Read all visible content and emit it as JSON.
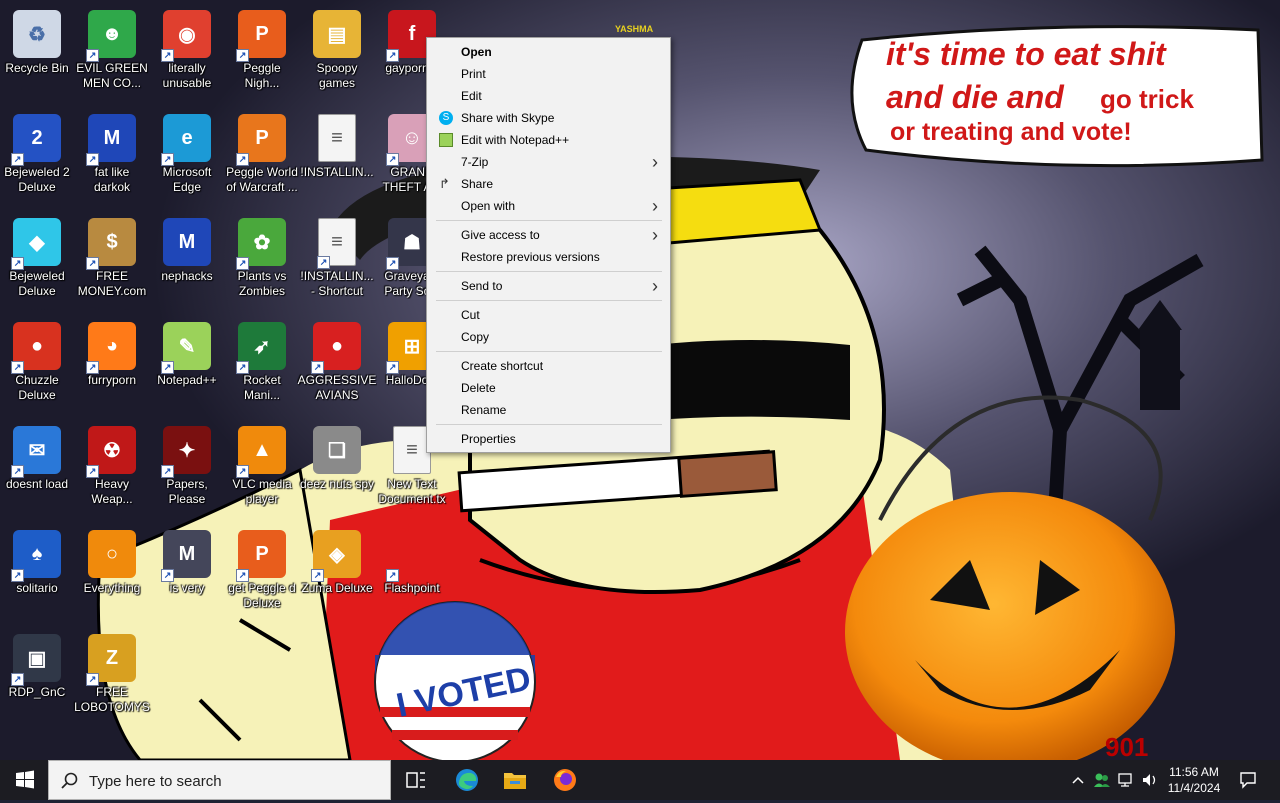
{
  "wallpaper": {
    "speech_line1": "it's time to eat shit",
    "speech_line2a": "and die and",
    "speech_line2b": "go trick",
    "speech_line3": "or treating and vote!",
    "badge_text": "I VOTED",
    "corner_text": "901"
  },
  "desktop": {
    "icons": [
      {
        "label": "Recycle Bin",
        "icon": "recycle-bin-icon",
        "shortcut": false
      },
      {
        "label": "EVIL GREEN\nMEN CO...",
        "icon": "green-men-icon",
        "shortcut": true
      },
      {
        "label": "literally\nunusable",
        "icon": "chrome-icon",
        "shortcut": true
      },
      {
        "label": "Peggle\nNigh...",
        "icon": "peggle-icon",
        "shortcut": true
      },
      {
        "label": "Spoopy\ngames",
        "icon": "folder-icon",
        "shortcut": false
      },
      {
        "label": "gayporn...",
        "icon": "flash-icon",
        "shortcut": true
      },
      {
        "label": "Bejeweled 2\nDeluxe",
        "icon": "bejeweled-2-icon",
        "shortcut": true
      },
      {
        "label": "fat like\ndarkok",
        "icon": "mpi-icon",
        "shortcut": true
      },
      {
        "label": "Microsoft\nEdge",
        "icon": "edge-icon",
        "shortcut": true
      },
      {
        "label": "Peggle World\nof Warcraft ...",
        "icon": "peggle-wow-icon",
        "shortcut": true
      },
      {
        "label": "!INSTALLIN...",
        "icon": "text-file-icon",
        "shortcut": false
      },
      {
        "label": "GRAND\nTHEFT A...",
        "icon": "gta-icon",
        "shortcut": true
      },
      {
        "label": "Bejeweled\nDeluxe",
        "icon": "diamond-icon",
        "shortcut": true
      },
      {
        "label": "FREE\nMONEY.com",
        "icon": "money-bag-icon",
        "shortcut": true
      },
      {
        "label": "nephacks",
        "icon": "mpi-icon",
        "shortcut": false
      },
      {
        "label": "Plants vs\nZombies",
        "icon": "pvz-icon",
        "shortcut": true
      },
      {
        "label": "!INSTALLIN...\n- Shortcut",
        "icon": "text-file-icon",
        "shortcut": true
      },
      {
        "label": "Graveya...\nParty Sc...",
        "icon": "graveyard-icon",
        "shortcut": true
      },
      {
        "label": "Chuzzle\nDeluxe",
        "icon": "chuzzle-icon",
        "shortcut": true
      },
      {
        "label": "furryporn",
        "icon": "firefox-icon",
        "shortcut": true
      },
      {
        "label": "Notepad++",
        "icon": "notepad-plus-icon",
        "shortcut": true
      },
      {
        "label": "Rocket\nMani...",
        "icon": "rocket-icon",
        "shortcut": true
      },
      {
        "label": "AGGRESSIVE\nAVIANS",
        "icon": "angry-bird-icon",
        "shortcut": true
      },
      {
        "label": "HalloDo...",
        "icon": "windows-logo-icon",
        "shortcut": true
      },
      {
        "label": "doesnt load",
        "icon": "thunderbird-icon",
        "shortcut": true
      },
      {
        "label": "Heavy\nWeap...",
        "icon": "radiation-icon",
        "shortcut": true
      },
      {
        "label": "Papers,\nPlease",
        "icon": "papers-please-icon",
        "shortcut": true
      },
      {
        "label": "VLC media\nplayer",
        "icon": "vlc-cone-icon",
        "shortcut": true
      },
      {
        "label": "deez nuts spy",
        "icon": "stacked-windows-icon",
        "shortcut": false
      },
      {
        "label": "New Text\nDocument.tx\nt",
        "icon": "text-file-icon",
        "shortcut": false
      },
      {
        "label": "solitario",
        "icon": "solitaire-icon",
        "shortcut": true
      },
      {
        "label": "Everything",
        "icon": "magnifier-icon",
        "shortcut": false
      },
      {
        "label": "is very",
        "icon": "mpi-shield-icon",
        "shortcut": true
      },
      {
        "label": "get Peggle d\nDeluxe",
        "icon": "peggle-icon",
        "shortcut": true
      },
      {
        "label": "Zuma Deluxe",
        "icon": "zuma-icon",
        "shortcut": true
      },
      {
        "label": "Flashpoint",
        "icon": "blank-icon",
        "shortcut": true
      },
      {
        "label": "RDP_GnC",
        "icon": "rdp-icon",
        "shortcut": true
      },
      {
        "label": "FREE\nLOBOTOMYS",
        "icon": "lobotomy-icon",
        "shortcut": true
      }
    ],
    "top_right_partial_label": "YASHMA"
  },
  "context_menu": {
    "items": [
      {
        "label": "Open",
        "bold": true
      },
      {
        "label": "Print"
      },
      {
        "label": "Edit"
      },
      {
        "label": "Share with Skype",
        "icon": "skype-icon"
      },
      {
        "label": "Edit with Notepad++",
        "icon": "notepad-plus-icon"
      },
      {
        "label": "7-Zip",
        "submenu": true
      },
      {
        "label": "Share",
        "icon": "share-icon"
      },
      {
        "label": "Open with",
        "submenu": true
      },
      {
        "label": "Give access to",
        "submenu": true
      },
      {
        "label": "Restore previous versions"
      },
      {
        "label": "Send to",
        "submenu": true
      },
      {
        "label": "Cut"
      },
      {
        "label": "Copy"
      },
      {
        "label": "Create shortcut"
      },
      {
        "label": "Delete"
      },
      {
        "label": "Rename"
      },
      {
        "label": "Properties"
      }
    ]
  },
  "taskbar": {
    "search_placeholder": "Type here to search",
    "apps": [
      "task-view-icon",
      "edge-icon",
      "file-explorer-icon",
      "firefox-icon"
    ],
    "tray": [
      "chevron-up-icon",
      "people-icon",
      "network-icon",
      "volume-icon"
    ],
    "time": "11:56 AM",
    "date": "11/4/2024",
    "notification_icon": "notification-icon"
  },
  "colors": {
    "speech_red": "#d01818",
    "menu_bg": "#f2f2f2",
    "taskbar_bg": "#1c1c22"
  }
}
